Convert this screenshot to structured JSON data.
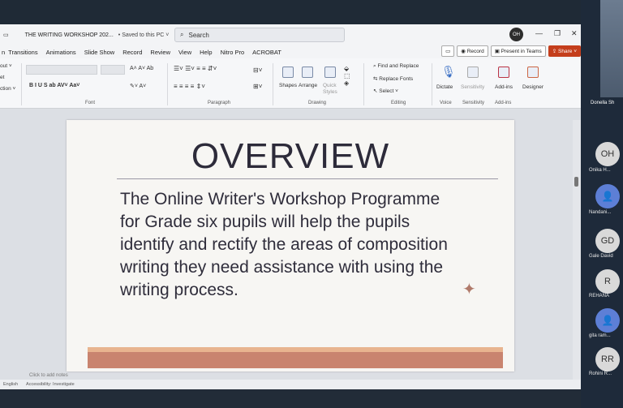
{
  "titlebar": {
    "doc_title": "THE WRITING WORKSHOP 202...",
    "saved": "• Saved to this PC ˅",
    "search_placeholder": "Search",
    "user_initials": "OH",
    "minimize": "—",
    "restore": "❐",
    "close": "✕"
  },
  "tabs": [
    "Transitions",
    "Animations",
    "Slide Show",
    "Record",
    "Review",
    "View",
    "Help",
    "Nitro Pro",
    "ACROBAT"
  ],
  "tab_left_fragment": "n",
  "right_buttons": {
    "record": "Record",
    "present_teams": "Present in Teams",
    "share": "Share"
  },
  "ribbon": {
    "left_fragments": [
      "out ˅",
      "et",
      "ction ˅"
    ],
    "font_label": "Font",
    "paragraph_label": "Paragraph",
    "drawing_label": "Drawing",
    "editing_label": "Editing",
    "voice_label": "Voice",
    "sensitivity_label": "Sensitivity",
    "addins_label": "Add-ins",
    "shapes": "Shapes",
    "arrange": "Arrange",
    "quick_styles": "Quick Styles",
    "find_replace": "Find and Replace",
    "replace_fonts": "Replace Fonts",
    "select": "Select ˅",
    "dictate": "Dictate",
    "sensitivity": "Sensitivity",
    "addins": "Add-ins",
    "designer": "Designer"
  },
  "slide": {
    "title": "OVERVIEW",
    "body": "The Online Writer's Workshop Programme for Grade six pupils will help the pupils identify and rectify the areas of composition writing they need assistance with using the writing process.",
    "sparkle": "✦"
  },
  "notes_placeholder": "Click to add notes",
  "status": {
    "left": "English",
    "accessibility": "Accessibility: Investigate"
  },
  "participants": {
    "top_name": "Donella Sh",
    "people": [
      {
        "initials": "OH",
        "name": "Onika H..."
      },
      {
        "initials": "",
        "name": "Nandani..."
      },
      {
        "initials": "GD",
        "name": "Gale David"
      },
      {
        "initials": "R",
        "name": "REHANA"
      },
      {
        "initials": "",
        "name": "gita ram..."
      },
      {
        "initials": "RR",
        "name": "Rohini R..."
      }
    ]
  },
  "colors": {
    "share": "#c43e1c",
    "slide_band": "#c9846f",
    "slide_band_light": "#e8b48f",
    "title_text": "#2d2b3a",
    "participant_bg": "#1e2a3a"
  }
}
